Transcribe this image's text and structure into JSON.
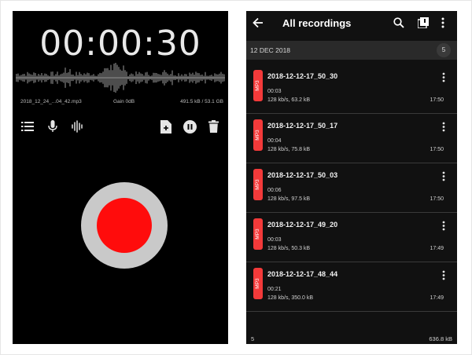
{
  "recorder": {
    "timer": "00:00:30",
    "file_name": "2018_12_24_...04_42.mp3",
    "gain": "Gain 0dB",
    "storage": "491.5 kB / 53.1 GB",
    "icons": [
      "list-icon",
      "microphone-icon",
      "waveform-icon",
      "add-file-icon",
      "pause-icon",
      "trash-icon"
    ],
    "record_color": "#ff0c0c"
  },
  "recordings": {
    "title": "All recordings",
    "date_header": "12 DEC 2018",
    "date_count": "5",
    "badge_label": "MP3",
    "accent": "#f33a3a",
    "items": [
      {
        "name": "2018-12-12-17_50_30",
        "duration": "00:03",
        "info": "128 kb/s, 63.2 kB",
        "time": "17:50"
      },
      {
        "name": "2018-12-12-17_50_17",
        "duration": "00:04",
        "info": "128 kb/s, 75.8 kB",
        "time": "17:50"
      },
      {
        "name": "2018-12-12-17_50_03",
        "duration": "00:06",
        "info": "128 kb/s, 97.5 kB",
        "time": "17:50"
      },
      {
        "name": "2018-12-12-17_49_20",
        "duration": "00:03",
        "info": "128 kb/s, 50.3 kB",
        "time": "17:49"
      },
      {
        "name": "2018-12-12-17_48_44",
        "duration": "00:21",
        "info": "128 kb/s, 350.0 kB",
        "time": "17:49"
      }
    ],
    "footer_count": "5",
    "footer_size": "636.8 kB"
  }
}
